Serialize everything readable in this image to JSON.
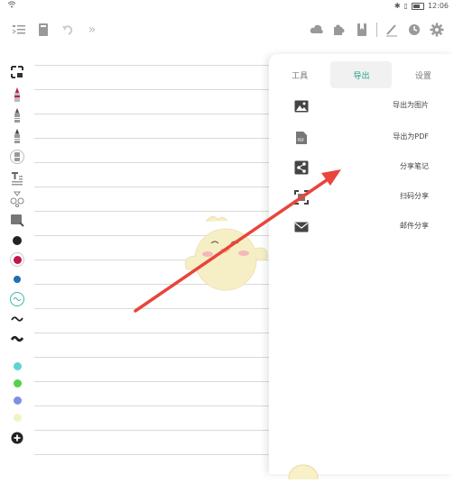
{
  "status_bar": {
    "time": "12:06"
  },
  "toolbar": {
    "left_icons": [
      "toc-icon",
      "notebook-icon",
      "undo-icon",
      "expand-icon"
    ],
    "right_icons": [
      "cloud-icon",
      "puzzle-icon",
      "bookmark-icon",
      "pen-icon",
      "timer-icon",
      "settings-icon"
    ]
  },
  "panel": {
    "tabs": [
      {
        "label": "工具",
        "active": false
      },
      {
        "label": "导出",
        "active": true
      },
      {
        "label": "设置",
        "active": false
      }
    ],
    "menu_items": [
      {
        "label": "导出为图片",
        "icon": "image-icon"
      },
      {
        "label": "导出为PDF",
        "icon": "pdf-icon"
      },
      {
        "label": "分享笔记",
        "icon": "share-icon"
      },
      {
        "label": "扫码分享",
        "icon": "qr-scan-icon"
      },
      {
        "label": "邮件分享",
        "icon": "mail-icon"
      }
    ]
  },
  "colors": {
    "accent": "#2aa08a",
    "annotation_arrow": "#e8453c",
    "palette": [
      "#222222",
      "#c2174a",
      "#1f6fb2",
      "#3fb5a6",
      "#222222",
      "#222222",
      "#5fd3cf",
      "#52d24a",
      "#7f8fe0",
      "#f3f2c7"
    ]
  }
}
